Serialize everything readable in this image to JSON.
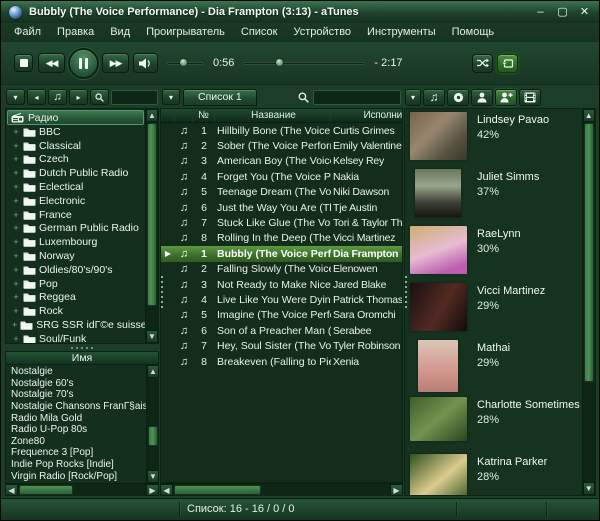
{
  "window": {
    "title": "Bubbly (The Voice Performance) - Dia Frampton (3:13) - aTunes"
  },
  "menu": {
    "items": [
      "Файл",
      "Правка",
      "Вид",
      "Проигрыватель",
      "Список",
      "Устройство",
      "Инструменты",
      "Помощь"
    ]
  },
  "player": {
    "elapsed": "0:56",
    "remaining": "- 2:17",
    "progress_percent": 29,
    "volume_percent": 45
  },
  "left": {
    "search_value": "",
    "root_label": "Радио",
    "stations": [
      "BBC",
      "Classical",
      "Czech",
      "Dutch Public Radio",
      "Eclectical",
      "Electronic",
      "France",
      "German Public Radio",
      "Luxembourg",
      "Norway",
      "Oldies/80's/90's",
      "Pop",
      "Reggea",
      "Rock",
      "SRG SSR idГ©e suisse",
      "Soul/Funk"
    ],
    "name_column_header": "Имя",
    "names": [
      "Nostalgie",
      "Nostalgie 60's",
      "Nostalgie 70's",
      "Nostalgie Chansons FranГ§aises",
      "Radio Mila Gold",
      "Radio U-Pop 80s",
      "Zone80",
      "Frequence 3 [Pop]",
      "Indie Pop Rocks [Indie]",
      "Virgin Radio [Rock/Pop]"
    ]
  },
  "playlist": {
    "tab_label": "Список 1",
    "search_value": "",
    "columns": {
      "num": "№",
      "title": "Название",
      "artist": "Исполни"
    },
    "rows": [
      {
        "num": "1",
        "title": "Hillbilly Bone (The Voice ...",
        "artist": "Curtis Grimes"
      },
      {
        "num": "2",
        "title": "Sober (The Voice Perform...",
        "artist": "Emily Valentine"
      },
      {
        "num": "3",
        "title": "American Boy (The Voice ...",
        "artist": "Kelsey Rey"
      },
      {
        "num": "4",
        "title": "Forget You (The Voice Pe...",
        "artist": "Nakia"
      },
      {
        "num": "5",
        "title": "Teenage Dream (The Voic...",
        "artist": "Niki Dawson"
      },
      {
        "num": "6",
        "title": "Just the Way You Are (Th...",
        "artist": "Tje Austin"
      },
      {
        "num": "7",
        "title": "Stuck Like Glue (The Voic...",
        "artist": "Tori & Taylor Th"
      },
      {
        "num": "8",
        "title": "Rolling In the Deep (The ...",
        "artist": "Vicci Martinez"
      },
      {
        "num": "1",
        "title": "Bubbly (The Voice Perfo...",
        "artist": "Dia Frampton",
        "playing": true
      },
      {
        "num": "2",
        "title": "Falling Slowly (The Voice ...",
        "artist": "Elenowen"
      },
      {
        "num": "3",
        "title": "Not Ready to Make Nice (...",
        "artist": "Jared Blake"
      },
      {
        "num": "4",
        "title": "Live Like You Were Dying ...",
        "artist": "Patrick Thomas"
      },
      {
        "num": "5",
        "title": "Imagine (The Voice Perfo...",
        "artist": "Sara Oromchi"
      },
      {
        "num": "6",
        "title": "Son of a Preacher Man (T...",
        "artist": "Serabee"
      },
      {
        "num": "7",
        "title": "Hey, Soul Sister (The Voic...",
        "artist": "Tyler Robinson"
      },
      {
        "num": "8",
        "title": "Breakeven (Falling to Piec...",
        "artist": "Xenia"
      }
    ]
  },
  "context": {
    "artists": [
      {
        "name": "Lindsey Pavao",
        "percent": "42%",
        "photo": "photo-1"
      },
      {
        "name": "Juliet Simms",
        "percent": "37%",
        "photo": "photo-2"
      },
      {
        "name": "RaeLynn",
        "percent": "30%",
        "photo": "photo-3"
      },
      {
        "name": "Vicci Martinez",
        "percent": "29%",
        "photo": "photo-4"
      },
      {
        "name": "Mathai",
        "percent": "29%",
        "photo": "photo-5"
      },
      {
        "name": "Charlotte Sometimes",
        "percent": "28%",
        "photo": "photo-6"
      },
      {
        "name": "Katrina Parker",
        "percent": "28%",
        "photo": "photo-7"
      }
    ]
  },
  "status": {
    "text": "Список: 16 - 16 / 0 / 0"
  },
  "theme": {
    "accent": "#3f7a50",
    "playing_row": "#5e9a42",
    "background": "#1c3d28"
  }
}
